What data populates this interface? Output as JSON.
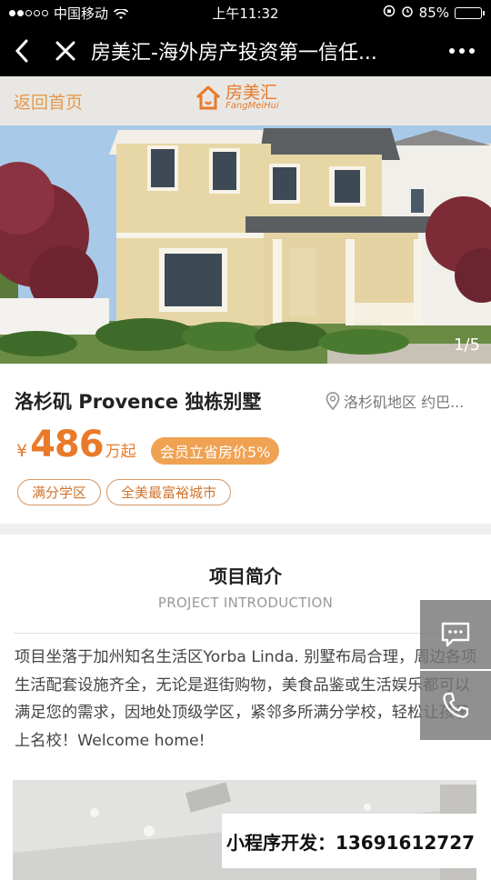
{
  "status_bar": {
    "carrier": "中国移动",
    "time": "上午11:32",
    "battery": "85%",
    "battery_level": 0.85
  },
  "nav": {
    "title": "房美汇-海外房产投资第一信任..."
  },
  "header": {
    "back_home": "返回首页",
    "logo_cn": "房美汇",
    "logo_en": "FangMeiHui"
  },
  "hero": {
    "page_counter": "1/5"
  },
  "property": {
    "title": "洛杉矶 Provence 独栋别墅",
    "location": "洛杉矶地区 约巴...",
    "currency": "¥",
    "price": "486",
    "price_unit": "万起",
    "member_badge": "会员立省房价5%",
    "tags": [
      "满分学区",
      "全美最富裕城市"
    ]
  },
  "intro": {
    "title": "项目简介",
    "subtitle": "PROJECT INTRODUCTION",
    "text": "项目坐落于加州知名生活区Yorba Linda. 别墅布局合理，周边各项生活配套设施齐全，无论是逛街购物，美食品鉴或生活娱乐都可以满足您的需求，因地处顶级学区，紧邻多所满分学校，轻松让孩子上名校！Welcome home!"
  },
  "ad": {
    "text": "小程序开发：13691612727"
  },
  "colors": {
    "accent": "#e87a2a",
    "badge": "#f0a253",
    "nav_bg": "#000000"
  }
}
